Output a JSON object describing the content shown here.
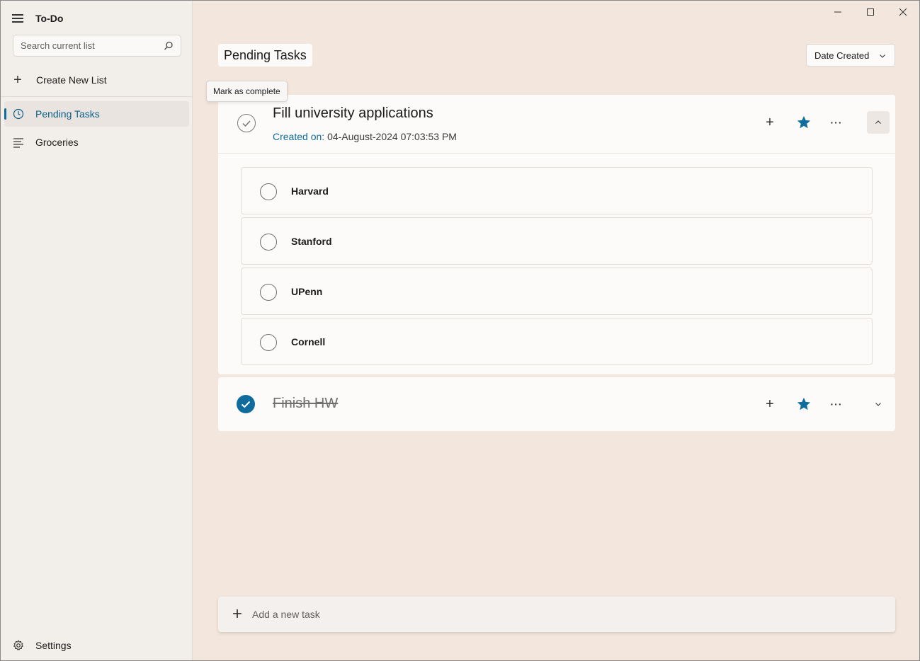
{
  "app": {
    "title": "To-Do"
  },
  "sidebar": {
    "search_placeholder": "Search current list",
    "create_list_label": "Create New List",
    "items": [
      {
        "label": "Pending Tasks",
        "icon": "clock-icon",
        "active": true
      },
      {
        "label": "Groceries",
        "icon": "list-icon",
        "active": false
      }
    ],
    "settings_label": "Settings"
  },
  "main": {
    "title": "Pending Tasks",
    "sort": {
      "selected": "Date Created"
    },
    "tooltip": "Mark as complete",
    "tasks": [
      {
        "title": "Fill university applications",
        "created_label": "Created on:",
        "created_value": "04-August-2024 07:03:53 PM",
        "completed": false,
        "starred": true,
        "expanded": true,
        "subtasks": [
          {
            "label": "Harvard"
          },
          {
            "label": "Stanford"
          },
          {
            "label": "UPenn"
          },
          {
            "label": "Cornell"
          }
        ]
      },
      {
        "title": "Finish HW",
        "completed": true,
        "starred": true,
        "expanded": false
      }
    ],
    "add_task_placeholder": "Add a new task"
  },
  "colors": {
    "accent": "#0f6c9c",
    "background": "#f3e6dc",
    "sidebar": "#f2eeea"
  }
}
